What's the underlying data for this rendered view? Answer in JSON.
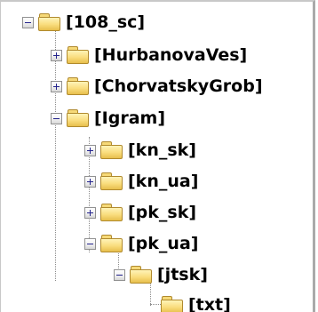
{
  "tree": {
    "nodes": [
      {
        "label": "[108_sc]",
        "state": "expanded"
      },
      {
        "label": "[HurbanovaVes]",
        "state": "collapsed"
      },
      {
        "label": "[ChorvatskyGrob]",
        "state": "collapsed"
      },
      {
        "label": "[Igram]",
        "state": "expanded"
      },
      {
        "label": "[kn_sk]",
        "state": "collapsed"
      },
      {
        "label": "[kn_ua]",
        "state": "collapsed"
      },
      {
        "label": "[pk_sk]",
        "state": "collapsed"
      },
      {
        "label": "[pk_ua]",
        "state": "expanded"
      },
      {
        "label": "[jtsk]",
        "state": "expanded"
      },
      {
        "label": "[txt]",
        "state": "leaf"
      }
    ]
  },
  "icons": {
    "folder": "folder-icon",
    "expand": "plus-box-icon",
    "collapse": "minus-box-icon"
  },
  "colors": {
    "folder_fill": "#f9dc7c",
    "folder_border": "#b08a2e",
    "expander_glyph": "#23238c",
    "tree_lines": "#8c8c8c",
    "panel_border": "#aaaaaa"
  }
}
